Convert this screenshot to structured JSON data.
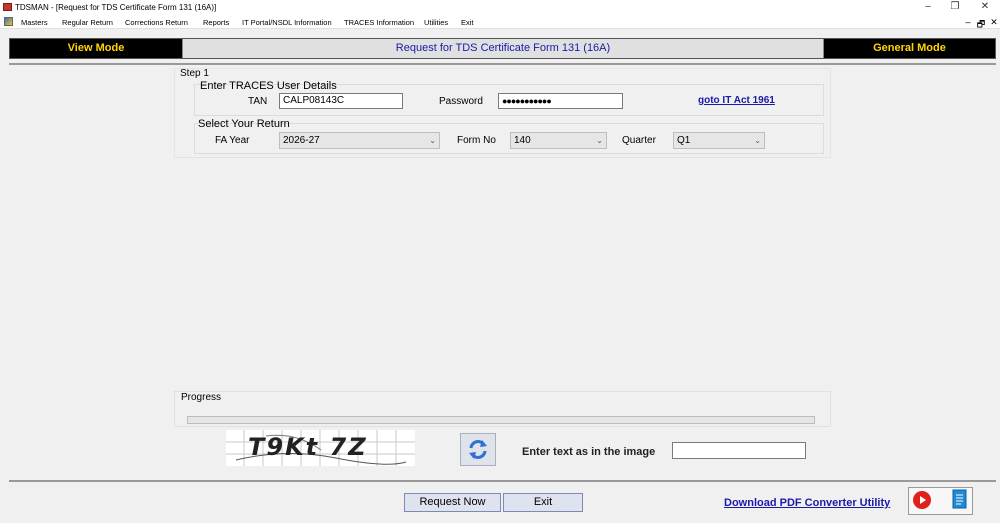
{
  "window": {
    "title": "TDSMAN - [Request for TDS Certificate Form 131 (16A)]",
    "controls": {
      "minimize": "–",
      "restore": "❐",
      "close": "✕"
    },
    "mdi_controls": {
      "minimize": "–",
      "restore": "🗗",
      "close": "✕"
    }
  },
  "menu": [
    "Masters",
    "Regular Return",
    "Corrections Return",
    "Reports",
    "IT Portal/NSDL Information",
    "TRACES Information",
    "Utilities",
    "Exit"
  ],
  "header": {
    "view_mode": "View Mode",
    "form_title": "Request for TDS Certificate Form 131 (16A)",
    "general_mode": "General Mode"
  },
  "step1": {
    "label": "Step 1",
    "traces_section": "Enter TRACES User Details",
    "tan_label": "TAN",
    "tan_value": "CALP08143C",
    "password_label": "Password",
    "password_value": "●●●●●●●●●●●",
    "it_act_link": "goto IT Act 1961",
    "return_section": "Select Your Return",
    "fa_year_label": "FA Year",
    "fa_year_value": "2026-27",
    "form_no_label": "Form No",
    "form_no_value": "140",
    "quarter_label": "Quarter",
    "quarter_value": "Q1"
  },
  "progress": {
    "label": "Progress",
    "value": 0
  },
  "captcha": {
    "image_text": "T9Kt 7Z",
    "prompt": "Enter text as in the image",
    "input_value": ""
  },
  "footer": {
    "request_now": "Request Now",
    "exit": "Exit",
    "download_link": "Download PDF Converter Utility"
  },
  "colors": {
    "mode_bg": "#000000",
    "mode_text": "#ffd700",
    "title_text": "#1a1aa8",
    "link": "#1a1aa8"
  },
  "icons": [
    "app-icon",
    "menu-app-icon",
    "refresh-icon",
    "youtube-icon",
    "document-icon"
  ]
}
